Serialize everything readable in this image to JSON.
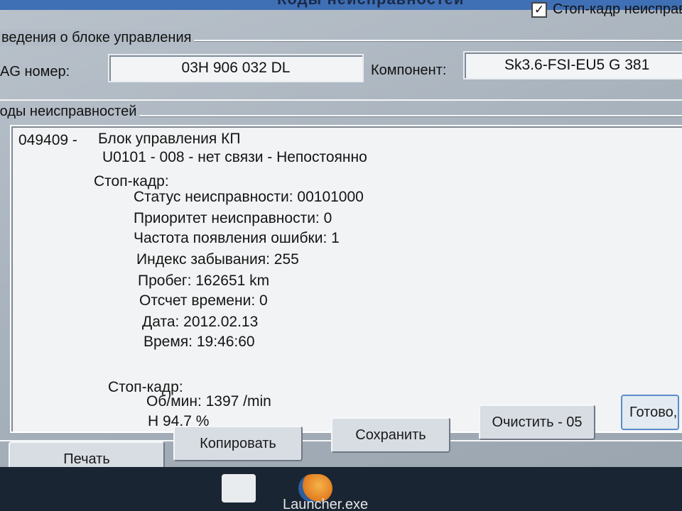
{
  "window": {
    "title": "Коды неисправностей",
    "freeze_frame_checkbox": {
      "checked": true,
      "mark": "✓",
      "label": "Стоп-кадр неисправ"
    }
  },
  "ecu_info": {
    "group_label": "ведения о блоке управления",
    "vag_label": "AG номер:",
    "vag_value": "03H 906 032 DL",
    "component_label": "Компонент:",
    "component_value": "Sk3.6-FSI-EU5   G   381"
  },
  "faults": {
    "group_label": "Коды неисправностей",
    "lines": [
      "049409 -",
      "Блок управления КП",
      "U0101 - 008 - нет связи - Непостоянно",
      "Стоп-кадр:",
      "Статус неисправности: 00101000",
      "Приоритет неисправности: 0",
      "Частота появления ошибки: 1",
      "Индекс забывания: 255",
      "Пробег: 162651 km",
      "Отсчет времени: 0",
      "Дата: 2012.02.13",
      "Время: 19:46:60",
      "Стоп-кадр:",
      "Об/мин: 1397 /min",
      "Н          94.7 %"
    ]
  },
  "buttons": {
    "print": "Печать",
    "copy": "Копировать",
    "save": "Сохранить",
    "clear": "Очистить - 05",
    "done": "Готово, Н"
  },
  "taskbar": {
    "launcher_label": "Launcher.exe"
  }
}
